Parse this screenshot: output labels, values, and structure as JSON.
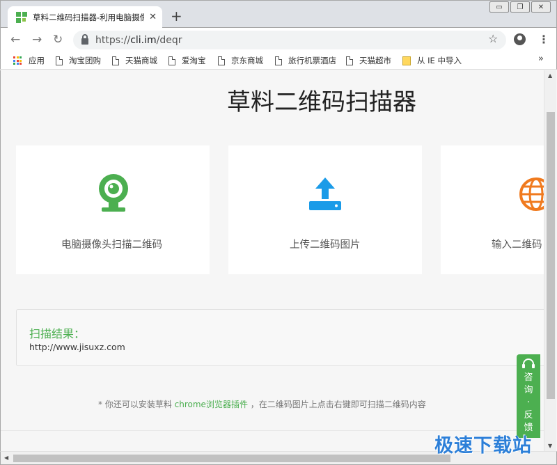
{
  "browser": {
    "tab_title": "草料二维码扫描器-利用电脑摄像",
    "tab_close": "✕",
    "new_tab": "+",
    "window_buttons": [
      "▭",
      "❐",
      "✕"
    ],
    "url_scheme": "https://",
    "url_host": "cli.im",
    "url_path": "/deqr",
    "bookmarks": [
      {
        "label": "应用",
        "icon": "apps-icon"
      },
      {
        "label": "淘宝团购",
        "icon": "page-icon"
      },
      {
        "label": "天猫商城",
        "icon": "page-icon"
      },
      {
        "label": "爱淘宝",
        "icon": "page-icon"
      },
      {
        "label": "京东商城",
        "icon": "page-icon"
      },
      {
        "label": "旅行机票酒店",
        "icon": "page-icon"
      },
      {
        "label": "天猫超市",
        "icon": "page-icon"
      },
      {
        "label": "从 IE 中导入",
        "icon": "folder-icon"
      }
    ],
    "bookmarks_more": "»"
  },
  "page": {
    "title": "草料二维码扫描器",
    "cards": [
      {
        "label": "电脑摄像头扫描二维码",
        "icon": "webcam-icon",
        "color": "#4caf50"
      },
      {
        "label": "上传二维码图片",
        "icon": "upload-icon",
        "color": "#1a9be8"
      },
      {
        "label": "输入二维码",
        "icon": "globe-icon",
        "color": "#f07a1e"
      }
    ],
    "result": {
      "title": "扫描结果：",
      "value": "http://www.jisuxz.com"
    },
    "tip": {
      "prefix": "* 你还可以安装草料",
      "link": "chrome浏览器插件",
      "suffix": "，在二维码图片上点击右键即可扫描二维码内容"
    },
    "feedback": [
      "咨",
      "询",
      "·",
      "反",
      "馈"
    ]
  },
  "colors": {
    "accent": "#4caf50",
    "upload": "#1a9be8",
    "globe": "#f07a1e"
  },
  "watermark": "极速下载站"
}
